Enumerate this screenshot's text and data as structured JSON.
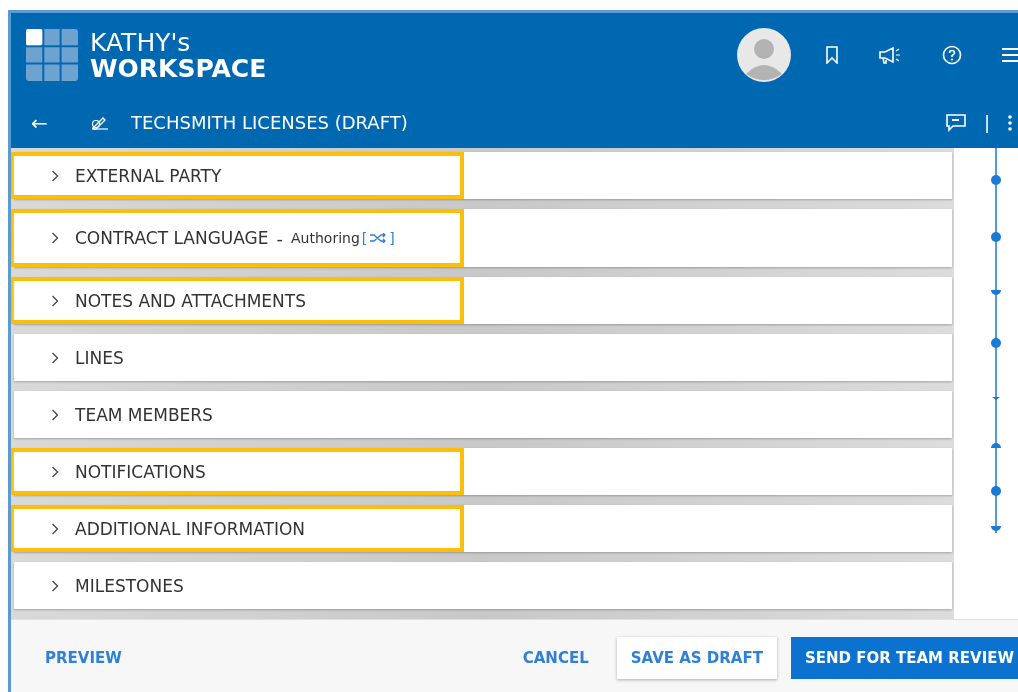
{
  "header": {
    "title_line1": "KATHY's",
    "title_line2": "WORKSPACE"
  },
  "subbar": {
    "back": "←",
    "title": "TECHSMITH LICENSES (DRAFT)",
    "separator": "|"
  },
  "sections": [
    {
      "label": "EXTERNAL PARTY",
      "highlighted": true
    },
    {
      "label": "CONTRACT LANGUAGE",
      "dash": "-",
      "suffix": "Authoring",
      "bracket_open": "[",
      "bracket_close": "]",
      "highlighted": true
    },
    {
      "label": "NOTES AND ATTACHMENTS",
      "highlighted": true
    },
    {
      "label": "LINES",
      "highlighted": false
    },
    {
      "label": "TEAM MEMBERS",
      "highlighted": false
    },
    {
      "label": "NOTIFICATIONS",
      "highlighted": true
    },
    {
      "label": "ADDITIONAL INFORMATION",
      "highlighted": true
    },
    {
      "label": "MILESTONES",
      "highlighted": false
    }
  ],
  "footer": {
    "preview": "PREVIEW",
    "cancel": "CANCEL",
    "save": "SAVE AS DRAFT",
    "send": "SEND FOR TEAM REVIEW"
  }
}
